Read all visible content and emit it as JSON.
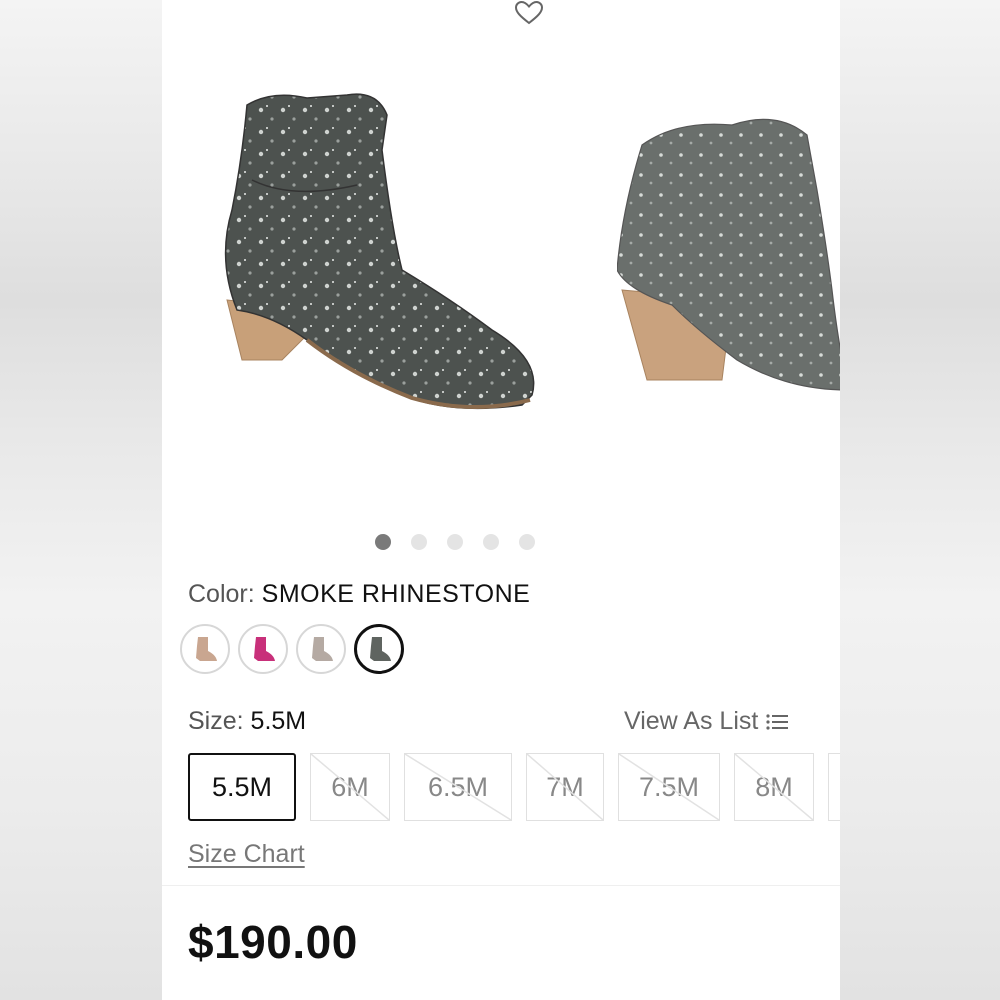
{
  "product": {
    "color_label": "Color:",
    "color_value": "SMOKE RHINESTONE",
    "size_label": "Size:",
    "size_value": "5.5M",
    "view_as_list": "View As List",
    "size_chart": "Size Chart",
    "price": "$190.00"
  },
  "gallery": {
    "current_image": 1,
    "image_count": 5
  },
  "swatches": [
    {
      "name": "tan",
      "color": "#c9a690",
      "selected": false
    },
    {
      "name": "pink",
      "color": "#c8307a",
      "selected": false
    },
    {
      "name": "taupe",
      "color": "#b5aaa3",
      "selected": false
    },
    {
      "name": "smoke",
      "color": "#5f6460",
      "selected": true
    }
  ],
  "sizes": [
    {
      "label": "5.5M",
      "selected": true,
      "available": true
    },
    {
      "label": "6M",
      "selected": false,
      "available": false
    },
    {
      "label": "6.5M",
      "selected": false,
      "available": false
    },
    {
      "label": "7M",
      "selected": false,
      "available": false
    },
    {
      "label": "7.5M",
      "selected": false,
      "available": false
    },
    {
      "label": "8M",
      "selected": false,
      "available": false
    }
  ],
  "icons": {
    "favorite": "heart-outline-icon",
    "list": "list-icon"
  }
}
